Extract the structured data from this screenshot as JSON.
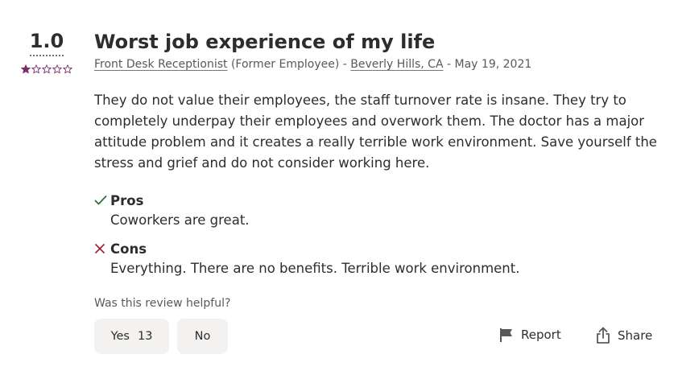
{
  "review": {
    "rating": "1.0",
    "stars_filled": 1,
    "stars_total": 5,
    "title": "Worst job experience of my life",
    "job_title": "Front Desk Receptionist",
    "employment_status": "(Former Employee)",
    "sep1": "-",
    "location": "Beverly Hills, CA",
    "sep2": "-",
    "date": "May 19, 2021",
    "body": "They do not value their employees, the staff turnover rate is insane. They try to completely underpay their employees and overwork them. The doctor has a major attitude problem and it creates a really terrible work environment. Save yourself the stress and grief and do not consider working here.",
    "pros_label": "Pros",
    "pros_text": "Coworkers are great.",
    "cons_label": "Cons",
    "cons_text": "Everything. There are no benefits. Terrible work environment."
  },
  "feedback": {
    "question": "Was this review helpful?",
    "yes_label": "Yes",
    "yes_count": "13",
    "no_label": "No",
    "report_label": "Report",
    "share_label": "Share"
  },
  "colors": {
    "star": "#7b2d6b",
    "pros_icon": "#2f6f3e",
    "cons_icon": "#a4152e"
  },
  "icons": {
    "pros": "check-icon",
    "cons": "x-icon",
    "report": "flag-icon",
    "share": "share-icon"
  }
}
